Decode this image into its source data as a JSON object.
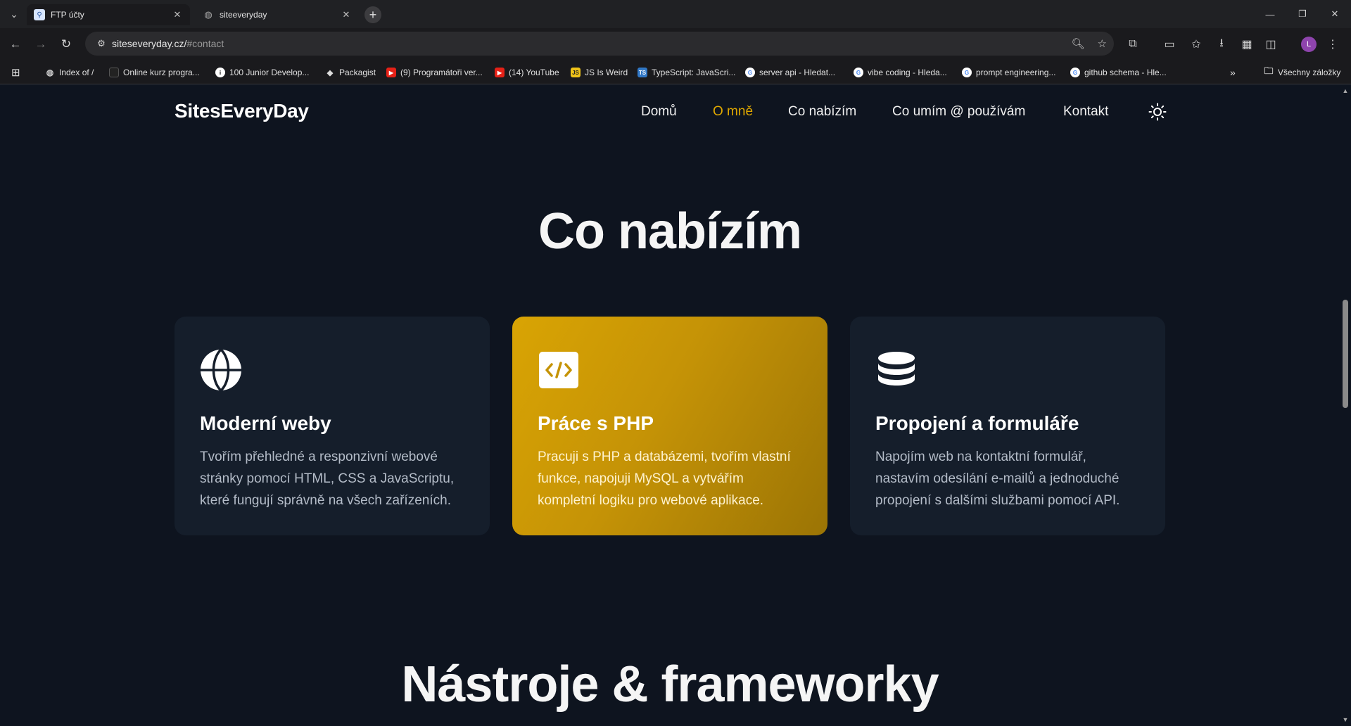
{
  "browser": {
    "tabs": [
      {
        "title": "FTP účty",
        "active": true
      },
      {
        "title": "siteeveryday",
        "active": false
      }
    ],
    "url_host": "siteseveryday.cz/",
    "url_path": "#contact",
    "profile_initial": "L",
    "bookmarks": [
      {
        "label": "Index of /",
        "icon": "globe-icon"
      },
      {
        "label": "Online kurz progra...",
        "icon": "github-icon"
      },
      {
        "label": "100 Junior Develop...",
        "icon": "info-icon"
      },
      {
        "label": "Packagist",
        "icon": "packagist-icon"
      },
      {
        "label": "(9) Programátoři ver...",
        "icon": "youtube-icon"
      },
      {
        "label": "(14) YouTube",
        "icon": "youtube-icon"
      },
      {
        "label": "JS Is Weird",
        "icon": "js-icon"
      },
      {
        "label": "TypeScript: JavaScri...",
        "icon": "ts-icon"
      },
      {
        "label": "server api - Hledat...",
        "icon": "google-icon"
      },
      {
        "label": "vibe coding - Hleda...",
        "icon": "google-icon"
      },
      {
        "label": "prompt engineering...",
        "icon": "google-icon"
      },
      {
        "label": "github schema - Hle...",
        "icon": "google-icon"
      }
    ],
    "all_bookmarks": "Všechny záložky",
    "colors": {
      "chrome_bg": "#202124",
      "toolbar_bg": "#1a1a1d",
      "profile": "#8e44ad"
    }
  },
  "site": {
    "logo": "SitesEveryDay",
    "nav": [
      {
        "label": "Domů",
        "current": false
      },
      {
        "label": "O mně",
        "current": true
      },
      {
        "label": "Co nabízím",
        "current": false
      },
      {
        "label": "Co umím @ používám",
        "current": false
      },
      {
        "label": "Kontakt",
        "current": false
      }
    ],
    "theme_toggle_icon": "sun-icon",
    "section_title": "Co nabízím",
    "cards": [
      {
        "icon": "globe-icon",
        "title": "Moderní weby",
        "text": "Tvořím přehledné a responzivní webové stránky pomocí HTML, CSS a JavaScriptu, které fungují správně na všech zařízeních.",
        "highlighted": false
      },
      {
        "icon": "code-icon",
        "title": "Práce s PHP",
        "text": "Pracuji s PHP a databázemi, tvořím vlastní funkce, napojuji MySQL a vytvářím kompletní logiku pro webové aplikace.",
        "highlighted": true
      },
      {
        "icon": "database-icon",
        "title": "Propojení a formuláře",
        "text": "Napojím web na kontaktní formulář, nastavím odesílání e-mailů a jednoduché propojení s dalšími službami pomocí API.",
        "highlighted": false
      }
    ],
    "next_section_title": "Nástroje & frameworky",
    "colors": {
      "page_bg": "#0e141f",
      "card_bg": "#151e2b",
      "accent": "#e0a800"
    }
  }
}
